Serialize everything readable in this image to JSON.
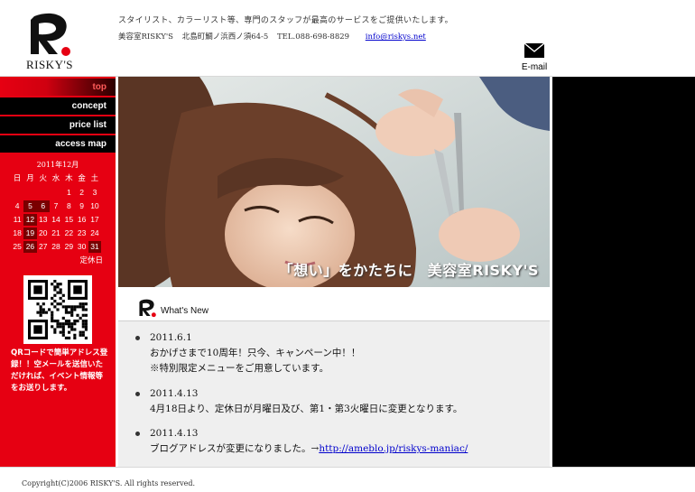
{
  "header": {
    "logo_text": "RISKY'S",
    "tagline": "スタイリスト、カラーリスト等、専門のスタッフが最高のサービスをご提供いたします。",
    "salon_name": "美容室RISKY'S",
    "address": "北島町鯛ノ浜西ノ須64-5",
    "tel": "TEL.088-698-8829",
    "email_address": "info@riskys.net",
    "email_label": "E-mail",
    "email_icon": "envelope-icon"
  },
  "nav": {
    "items": [
      {
        "label": "top",
        "active": true
      },
      {
        "label": "concept",
        "active": false
      },
      {
        "label": "price list",
        "active": false
      },
      {
        "label": "access map",
        "active": false
      }
    ]
  },
  "calendar": {
    "title": "2011年12月",
    "weekdays": [
      "日",
      "月",
      "火",
      "水",
      "木",
      "金",
      "土"
    ],
    "weeks": [
      [
        "",
        "",
        "",
        "",
        "1",
        "2",
        "3"
      ],
      [
        "4",
        "5",
        "6",
        "7",
        "8",
        "9",
        "10"
      ],
      [
        "11",
        "12",
        "13",
        "14",
        "15",
        "16",
        "17"
      ],
      [
        "18",
        "19",
        "20",
        "21",
        "22",
        "23",
        "24"
      ],
      [
        "25",
        "26",
        "27",
        "28",
        "29",
        "30",
        "31"
      ]
    ],
    "closed_days": [
      "5",
      "6",
      "12",
      "19",
      "26",
      "31"
    ],
    "closed_note": "定休日"
  },
  "qr": {
    "caption": "QRコードで簡単アドレス登録！！空メールを送信いただければ、イベント情報等をお送りします。"
  },
  "hero": {
    "caption": "「想い」をかたちに　美容室RISKY'S"
  },
  "news": {
    "title": "What's New",
    "items": [
      {
        "date": "2011.6.1",
        "lines": [
          "おかげさまで10周年！只今、キャンペーン中！！",
          "※特別限定メニューをご用意しています。"
        ],
        "link": ""
      },
      {
        "date": "2011.4.13",
        "lines": [
          "4月18日より、定休日が月曜日及び、第1・第3火曜日に変更となります。"
        ],
        "link": ""
      },
      {
        "date": "2011.4.13",
        "lines": [
          "ブログアドレスが変更になりました。→"
        ],
        "link": "http://ameblo.jp/riskys-maniac/"
      }
    ]
  },
  "footer": {
    "copyright": "Copyright(C)2006 RISKY'S.  All rights reserved."
  },
  "colors": {
    "brand_red": "#e60012",
    "nav_black": "#000000",
    "closed_day": "#7a0000",
    "link_blue": "#0000cc"
  }
}
